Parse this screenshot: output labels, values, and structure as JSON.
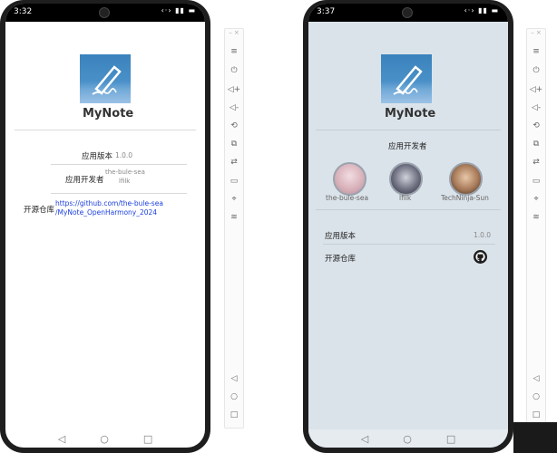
{
  "left": {
    "status_time": "3:32",
    "status_icons": "‹·› ▮▮ ▬",
    "app_name": "MyNote",
    "version_label": "应用版本",
    "version_value": "1.0.0",
    "developers_label": "应用开发者",
    "developer_1": "the-bule-sea",
    "developer_2": "lfilk",
    "repo_label": "开源仓库",
    "repo_url_line1": "https://github.com/the-bule-sea",
    "repo_url_line2": "/MyNote_OpenHarmony_2024"
  },
  "right": {
    "status_time": "3:37",
    "status_icons": "‹·› ▮▮ ▬",
    "app_name": "MyNote",
    "developers_title": "应用开发者",
    "developers": [
      {
        "name": "the-bule-sea"
      },
      {
        "name": "lfilk"
      },
      {
        "name": "TechNinja-Sun"
      }
    ],
    "version_label": "应用版本",
    "version_value": "1.0.0",
    "repo_label": "开源仓库"
  },
  "toolbar": {
    "window_controls": "–  ×",
    "icons": [
      "menu-icon",
      "power-icon",
      "volume-up-icon",
      "volume-down-icon",
      "rotate-icon",
      "screenshot-icon",
      "swap-icon",
      "battery-icon",
      "location-icon",
      "wifi-icon",
      "back-icon",
      "home-icon",
      "recent-icon"
    ]
  },
  "nav": {
    "back": "◁",
    "home": "○",
    "recent": "□"
  },
  "colors": {
    "right_bg": "#dbe3ea",
    "link": "#1a3ee0",
    "logo_blue": "#3a82bc"
  }
}
